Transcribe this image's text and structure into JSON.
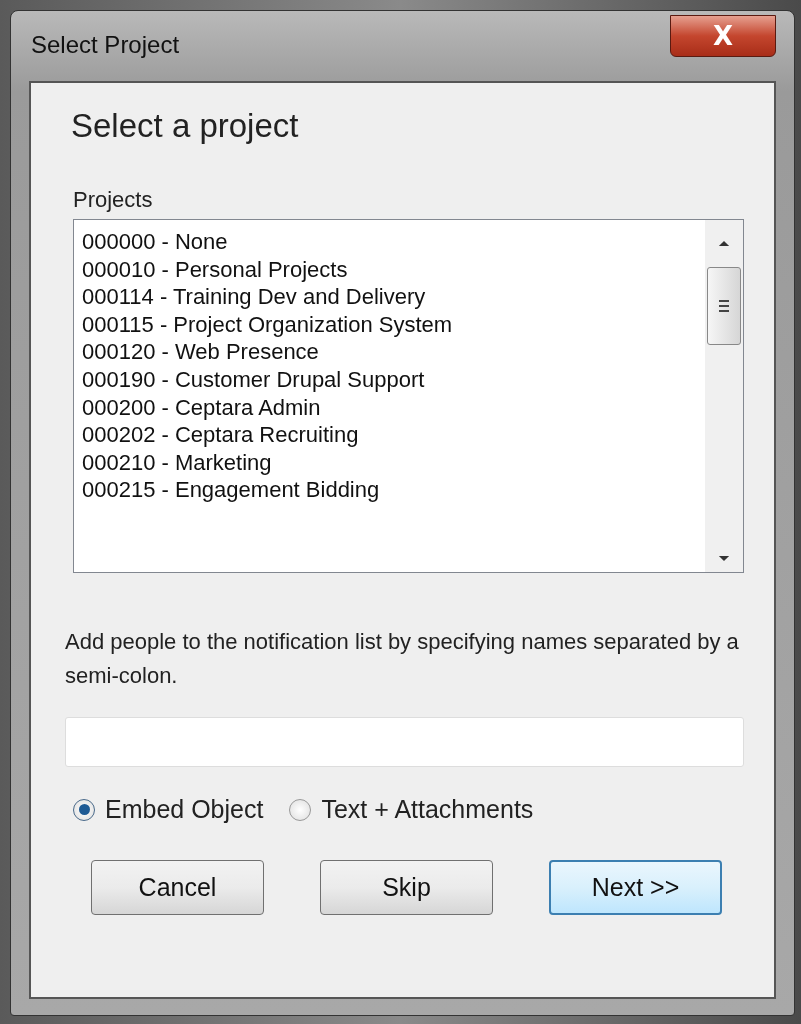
{
  "window": {
    "title": "Select Project",
    "close_label": "X"
  },
  "heading": "Select a project",
  "projects": {
    "label": "Projects",
    "items": [
      "000000 - None",
      "000010 - Personal Projects",
      "000114 - Training Dev and Delivery",
      "000115 - Project Organization System",
      "000120 - Web Presence",
      "000190 - Customer Drupal Support",
      "000200 - Ceptara Admin",
      "000202 - Ceptara Recruiting",
      "000210 - Marketing",
      "000215 - Engagement Bidding"
    ]
  },
  "notification": {
    "text": "Add people to the notification list by specifying names separated by a semi-colon."
  },
  "options": [
    {
      "label": "Embed Object",
      "selected": true
    },
    {
      "label": "Text + Attachments",
      "selected": false
    }
  ],
  "buttons": [
    {
      "label": "Cancel",
      "default": false
    },
    {
      "label": "Skip",
      "default": false
    },
    {
      "label": "Next >>",
      "default": true
    }
  ]
}
